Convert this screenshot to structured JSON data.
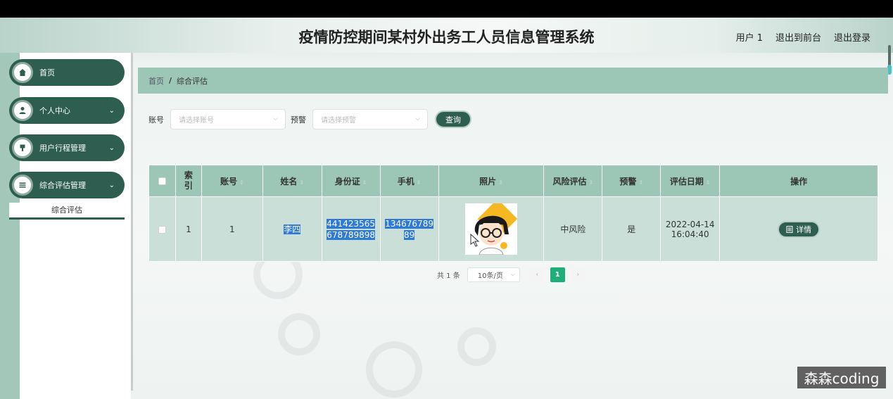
{
  "app": {
    "title": "疫情防控期间某村外出务工人员信息管理系统",
    "user_label": "用户 1",
    "to_front": "退出到前台",
    "logout": "退出登录"
  },
  "sidebar": {
    "items": [
      {
        "label": "首页",
        "icon": "home-icon"
      },
      {
        "label": "个人中心",
        "icon": "user-icon"
      },
      {
        "label": "用户行程管理",
        "icon": "pin-icon"
      },
      {
        "label": "综合评估管理",
        "icon": "list-icon"
      }
    ],
    "active_sub": "综合评估"
  },
  "breadcrumb": {
    "home": "首页",
    "sep": "/",
    "current": "综合评估"
  },
  "filters": {
    "account_label": "账号",
    "account_placeholder": "请选择账号",
    "warning_label": "预警",
    "warning_placeholder": "请选择预警",
    "query": "查询"
  },
  "table": {
    "headers": [
      "索引",
      "账号",
      "姓名",
      "身份证",
      "手机",
      "照片",
      "风险评估",
      "预警",
      "评估日期",
      "操作"
    ],
    "rows": [
      {
        "index": "1",
        "account": "1",
        "name": "李四",
        "id_card_1": "441423565",
        "id_card_2": "678789898",
        "phone_1": "134676789",
        "phone_2": "89",
        "risk": "中风险",
        "warning": "是",
        "date": "2022-04-14",
        "time": "16:04:40",
        "action": "详情"
      }
    ]
  },
  "pagination": {
    "total": "共 1 条",
    "page_size": "10条/页",
    "current": "1",
    "prev": "‹",
    "next": "›"
  },
  "watermark": "森森coding",
  "colors": {
    "primary": "#2d5e4f",
    "accent": "#9cc6b6",
    "row": "#c9dfd7",
    "page_active": "#1fae7a"
  }
}
